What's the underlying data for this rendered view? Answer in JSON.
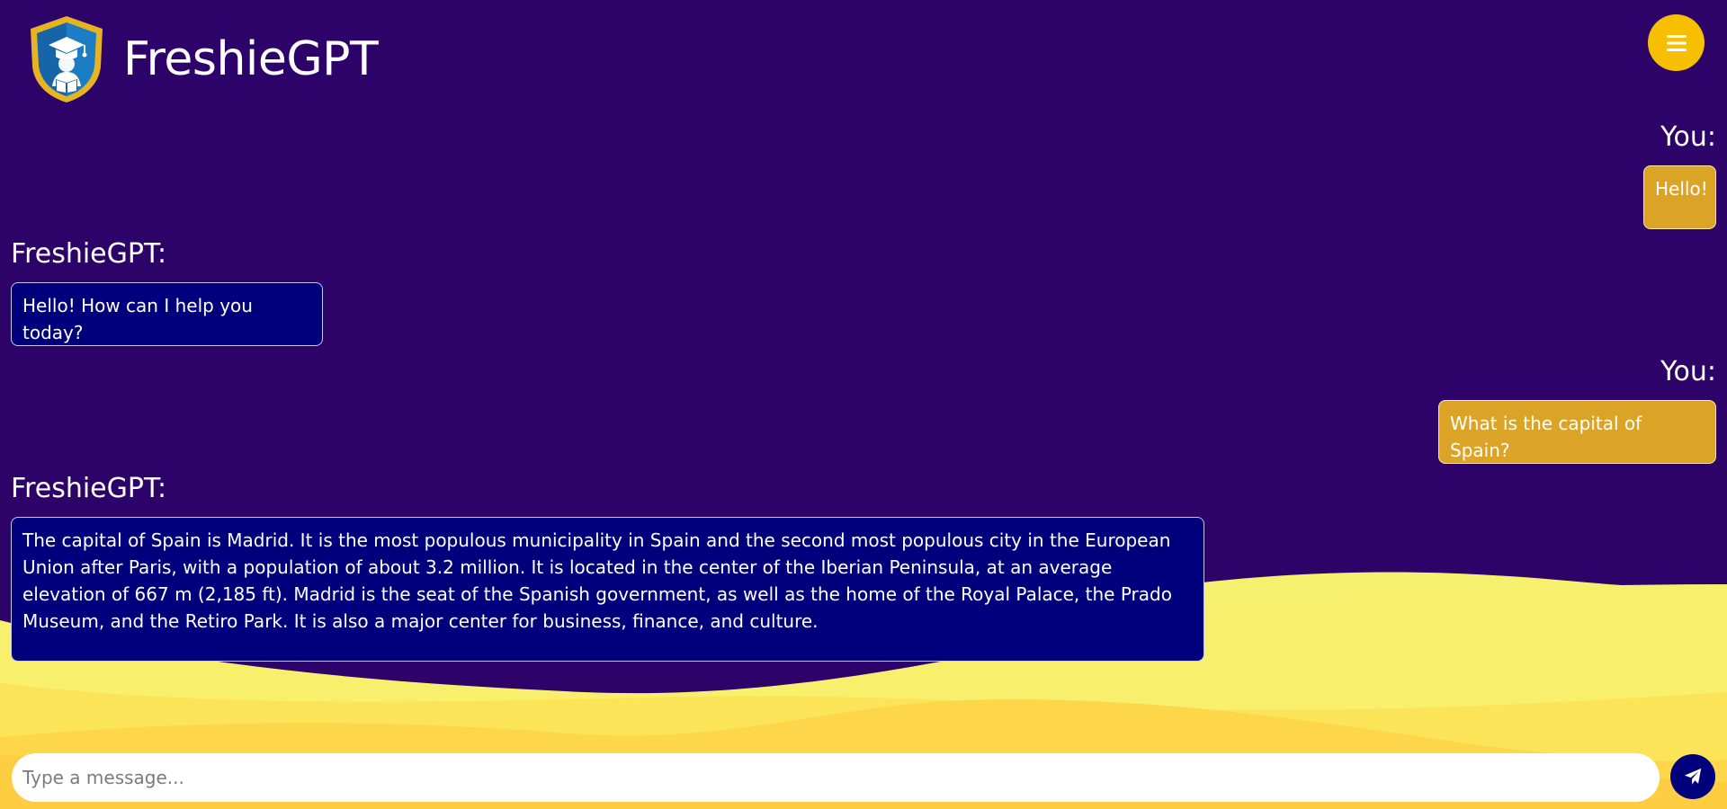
{
  "app": {
    "title": "FreshieGPT",
    "logo_icon": "graduation-shield-logo"
  },
  "header": {
    "menu_icon": "hamburger-menu-icon"
  },
  "colors": {
    "background": "#2e0369",
    "user_bubble": "#dba427",
    "bot_bubble": "#00007c",
    "accent": "#f6c000",
    "send_button": "#00007c"
  },
  "messages": [
    {
      "role": "user",
      "speaker": "You:",
      "text": "Hello!"
    },
    {
      "role": "bot",
      "speaker": "FreshieGPT:",
      "text": "Hello! How can I help you today?"
    },
    {
      "role": "user",
      "speaker": "You:",
      "text": "What is the capital of Spain?"
    },
    {
      "role": "bot",
      "speaker": "FreshieGPT:",
      "text": "The capital of Spain is Madrid. It is the most populous municipality in Spain and the second most populous city in the European Union after Paris, with a population of about 3.2 million. It is located in the center of the Iberian Peninsula, at an average elevation of 667 m (2,185 ft). Madrid is the seat of the Spanish government, as well as the home of the Royal Palace, the Prado Museum, and the Retiro Park. It is also a major center for business, finance, and culture."
    }
  ],
  "composer": {
    "placeholder": "Type a message...",
    "value": "",
    "send_icon": "paper-plane-icon"
  }
}
